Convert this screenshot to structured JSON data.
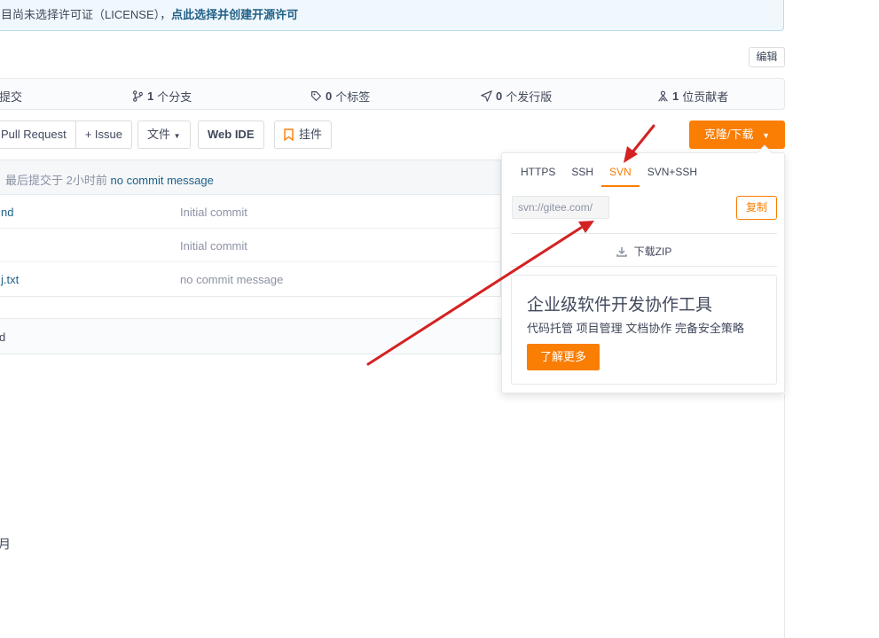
{
  "license_banner": {
    "text": "目尚未选择许可证（LICENSE），",
    "link": "点此选择并创建开源许可"
  },
  "edit_label": "编辑",
  "stats": {
    "commits_label": "提交",
    "branches_count": "1",
    "branches_label": "个分支",
    "tags_count": "0",
    "tags_label": "个标签",
    "releases_count": "0",
    "releases_label": "个发行版",
    "contributors_count": "1",
    "contributors_label": "位贡献者"
  },
  "toolbar": {
    "pull_request": "Pull Request",
    "issue": "+ Issue",
    "file": "文件",
    "web_ide": "Web IDE",
    "pendant": "挂件",
    "clone_download": "克隆/下载"
  },
  "commit_header": {
    "label": "最后提交于",
    "time": "2小时前",
    "message": "no commit message"
  },
  "files": [
    {
      "name": "nd",
      "message": "Initial commit"
    },
    {
      "name": "",
      "message": "Initial commit"
    },
    {
      "name": "j.txt",
      "message": "no commit message"
    }
  ],
  "readme_title": "d",
  "month_text": "月",
  "clone_popover": {
    "tabs": [
      "HTTPS",
      "SSH",
      "SVN",
      "SVN+SSH"
    ],
    "active_tab": "SVN",
    "url_value": "svn://gitee.com/",
    "copy_label": "复制",
    "download_zip": "下载ZIP",
    "ad": {
      "title": "企业级软件开发协作工具",
      "subtitle": "代码托管 项目管理 文档协作 完备安全策略",
      "button": "了解更多"
    }
  },
  "colors": {
    "accent": "#fa7d04",
    "link": "#1f5f87",
    "annotation_arrow": "#d42222"
  }
}
